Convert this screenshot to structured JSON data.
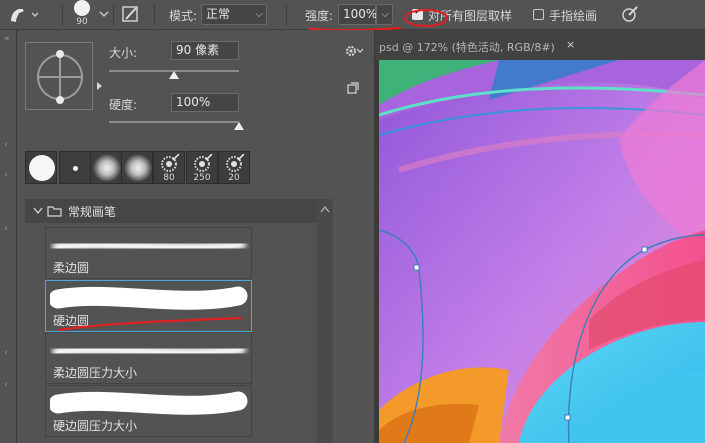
{
  "options_bar": {
    "brush_tool_icon": "smudge-finger-icon",
    "brush_size": "90",
    "mode_label": "模式:",
    "mode_value": "正常",
    "strength_label": "强度:",
    "strength_value": "100%",
    "sample_all_layers_label": "对所有图层取样",
    "sample_all_layers_checked": true,
    "finger_paint_label": "手指绘画",
    "finger_paint_checked": false
  },
  "brush_panel": {
    "size_label": "大小:",
    "size_value": "90 像素",
    "size_fraction": 0.5,
    "hardness_label": "硬度:",
    "hardness_value": "100%",
    "hardness_fraction": 1.0,
    "recent_presets": [
      {
        "kind": "hard-round",
        "label": ""
      },
      {
        "kind": "small-dot",
        "label": ""
      },
      {
        "kind": "soft-round",
        "label": ""
      },
      {
        "kind": "soft-round",
        "label": ""
      },
      {
        "kind": "textured",
        "label": "80"
      },
      {
        "kind": "textured",
        "label": "250"
      },
      {
        "kind": "textured",
        "label": "20"
      }
    ],
    "group_name": "常规画笔",
    "brushes": [
      {
        "name": "柔边圆",
        "style": "soft"
      },
      {
        "name": "硬边圆",
        "style": "hard",
        "selected": true
      },
      {
        "name": "柔边圆压力大小",
        "style": "soft"
      },
      {
        "name": "硬边圆压力大小",
        "style": "hard"
      }
    ]
  },
  "document": {
    "tab_title": "psd @ 172% (特色活动, RGB/8#)",
    "close_glyph": "×"
  },
  "colors": {
    "ui_bg": "#535353",
    "selection_border": "#4ba7df",
    "annotation_red": "#e02020"
  }
}
